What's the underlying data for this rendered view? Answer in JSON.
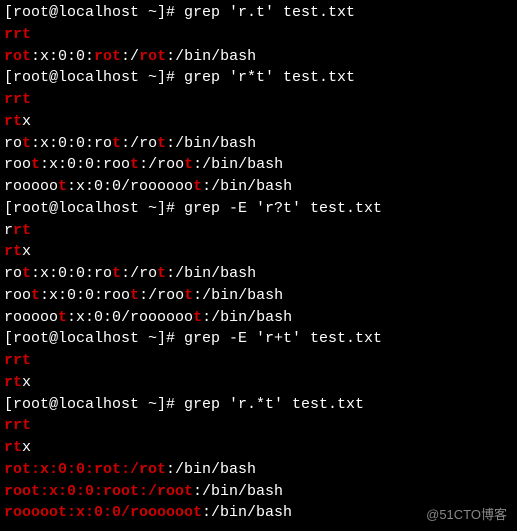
{
  "watermark": "@51CTO博客",
  "lines": [
    {
      "segs": [
        {
          "c": "w",
          "t": "[root@localhost ~]# grep 'r.t' test.txt"
        }
      ]
    },
    {
      "segs": [
        {
          "c": "r",
          "t": "rrt"
        }
      ]
    },
    {
      "segs": [
        {
          "c": "r",
          "t": "rot"
        },
        {
          "c": "w",
          "t": ":x:0:0:"
        },
        {
          "c": "r",
          "t": "rot"
        },
        {
          "c": "w",
          "t": ":/"
        },
        {
          "c": "r",
          "t": "rot"
        },
        {
          "c": "w",
          "t": ":/bin/bash"
        }
      ]
    },
    {
      "segs": [
        {
          "c": "w",
          "t": "[root@localhost ~]# grep 'r*t' test.txt"
        }
      ]
    },
    {
      "segs": [
        {
          "c": "r",
          "t": "rrt"
        }
      ]
    },
    {
      "segs": [
        {
          "c": "r",
          "t": "rt"
        },
        {
          "c": "w",
          "t": "x"
        }
      ]
    },
    {
      "segs": [
        {
          "c": "w",
          "t": "ro"
        },
        {
          "c": "r",
          "t": "t"
        },
        {
          "c": "w",
          "t": ":x:0:0:ro"
        },
        {
          "c": "r",
          "t": "t"
        },
        {
          "c": "w",
          "t": ":/ro"
        },
        {
          "c": "r",
          "t": "t"
        },
        {
          "c": "w",
          "t": ":/bin/bash"
        }
      ]
    },
    {
      "segs": [
        {
          "c": "w",
          "t": "roo"
        },
        {
          "c": "r",
          "t": "t"
        },
        {
          "c": "w",
          "t": ":x:0:0:roo"
        },
        {
          "c": "r",
          "t": "t"
        },
        {
          "c": "w",
          "t": ":/roo"
        },
        {
          "c": "r",
          "t": "t"
        },
        {
          "c": "w",
          "t": ":/bin/bash"
        }
      ]
    },
    {
      "segs": [
        {
          "c": "w",
          "t": "rooooo"
        },
        {
          "c": "r",
          "t": "t"
        },
        {
          "c": "w",
          "t": ":x:0:0/roooooo"
        },
        {
          "c": "r",
          "t": "t"
        },
        {
          "c": "w",
          "t": ":/bin/bash"
        }
      ]
    },
    {
      "segs": [
        {
          "c": "w",
          "t": "[root@localhost ~]# grep -E 'r?t' test.txt"
        }
      ]
    },
    {
      "segs": [
        {
          "c": "w",
          "t": "r"
        },
        {
          "c": "r",
          "t": "rt"
        }
      ]
    },
    {
      "segs": [
        {
          "c": "r",
          "t": "rt"
        },
        {
          "c": "w",
          "t": "x"
        }
      ]
    },
    {
      "segs": [
        {
          "c": "w",
          "t": "ro"
        },
        {
          "c": "r",
          "t": "t"
        },
        {
          "c": "w",
          "t": ":x:0:0:ro"
        },
        {
          "c": "r",
          "t": "t"
        },
        {
          "c": "w",
          "t": ":/ro"
        },
        {
          "c": "r",
          "t": "t"
        },
        {
          "c": "w",
          "t": ":/bin/bash"
        }
      ]
    },
    {
      "segs": [
        {
          "c": "w",
          "t": "roo"
        },
        {
          "c": "r",
          "t": "t"
        },
        {
          "c": "w",
          "t": ":x:0:0:roo"
        },
        {
          "c": "r",
          "t": "t"
        },
        {
          "c": "w",
          "t": ":/roo"
        },
        {
          "c": "r",
          "t": "t"
        },
        {
          "c": "w",
          "t": ":/bin/bash"
        }
      ]
    },
    {
      "segs": [
        {
          "c": "w",
          "t": "rooooo"
        },
        {
          "c": "r",
          "t": "t"
        },
        {
          "c": "w",
          "t": ":x:0:0/roooooo"
        },
        {
          "c": "r",
          "t": "t"
        },
        {
          "c": "w",
          "t": ":/bin/bash"
        }
      ]
    },
    {
      "segs": [
        {
          "c": "w",
          "t": "[root@localhost ~]# grep -E 'r+t' test.txt"
        }
      ]
    },
    {
      "segs": [
        {
          "c": "r",
          "t": "rrt"
        }
      ]
    },
    {
      "segs": [
        {
          "c": "r",
          "t": "rt"
        },
        {
          "c": "w",
          "t": "x"
        }
      ]
    },
    {
      "segs": [
        {
          "c": "w",
          "t": "[root@localhost ~]# grep 'r.*t' test.txt"
        }
      ]
    },
    {
      "segs": [
        {
          "c": "r",
          "t": "rrt"
        }
      ]
    },
    {
      "segs": [
        {
          "c": "r",
          "t": "rt"
        },
        {
          "c": "w",
          "t": "x"
        }
      ]
    },
    {
      "segs": [
        {
          "c": "r",
          "t": "rot:x:0:0:rot:/rot"
        },
        {
          "c": "w",
          "t": ":/bin/bash"
        }
      ]
    },
    {
      "segs": [
        {
          "c": "r",
          "t": "root:x:0:0:root:/root"
        },
        {
          "c": "w",
          "t": ":/bin/bash"
        }
      ]
    },
    {
      "segs": [
        {
          "c": "r",
          "t": "rooooot:x:0:0/roooooot"
        },
        {
          "c": "w",
          "t": ":/bin/bash"
        }
      ]
    }
  ]
}
